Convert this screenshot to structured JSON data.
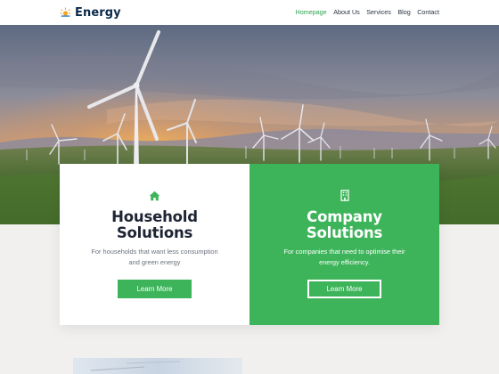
{
  "brand": {
    "name": "Energy",
    "icon": "sun-icon"
  },
  "nav": {
    "items": [
      {
        "label": "Homepage",
        "active": true
      },
      {
        "label": "About Us",
        "active": false
      },
      {
        "label": "Services",
        "active": false
      },
      {
        "label": "Blog",
        "active": false
      },
      {
        "label": "Contact",
        "active": false
      }
    ]
  },
  "colors": {
    "accent": "#3db45a",
    "nav_active": "#2ea44f",
    "heading": "#1d2433"
  },
  "hero": {
    "image": "wind-turbines-at-sunset"
  },
  "cards": {
    "household": {
      "icon": "house-icon",
      "title_line1": "Household",
      "title_line2": "Solutions",
      "desc_line1": "For households that want less consumption",
      "desc_line2": "and green energy",
      "button": "Learn More"
    },
    "company": {
      "icon": "building-icon",
      "title_line1": "Company",
      "title_line2": "Solutions",
      "desc_line1": "For companies that need to optimise their",
      "desc_line2": "energy efficiency.",
      "button": "Learn More"
    }
  }
}
